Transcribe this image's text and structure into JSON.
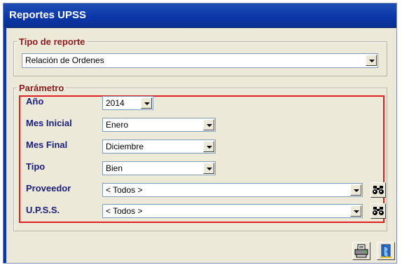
{
  "window": {
    "title": "Reportes UPSS"
  },
  "tipo_reporte": {
    "legend": "Tipo de reporte",
    "value": "Relación de Ordenes"
  },
  "parametro": {
    "legend": "Parámetro",
    "fields": {
      "anio": {
        "label": "Año",
        "value": "2014"
      },
      "mes_inicial": {
        "label": "Mes Inicial",
        "value": "Enero"
      },
      "mes_final": {
        "label": "Mes Final",
        "value": "Diciembre"
      },
      "tipo": {
        "label": "Tipo",
        "value": "Bien"
      },
      "proveedor": {
        "label": "Proveedor",
        "value": "< Todos >"
      },
      "upss": {
        "label": "U.P.S.S.",
        "value": "< Todos >"
      }
    }
  },
  "colors": {
    "highlight": "#e02020",
    "titlebar": "#0a36a8",
    "label": "#1a1e7a",
    "legend": "#8a1a1a"
  },
  "icons": [
    "binoculars-icon",
    "printer-icon",
    "exit-door-icon"
  ]
}
